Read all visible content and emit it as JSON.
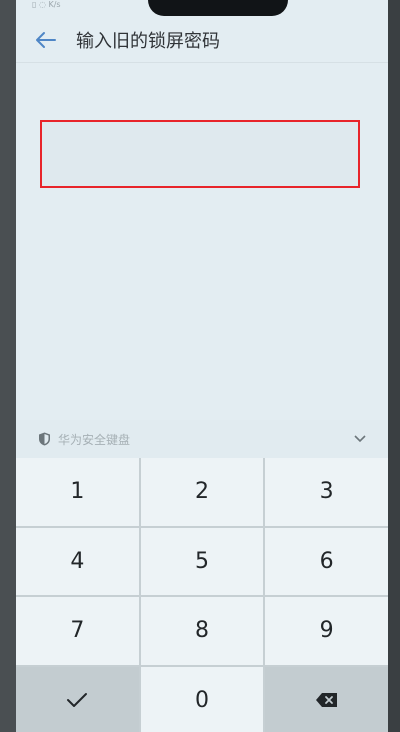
{
  "header": {
    "title": "输入旧的锁屏密码"
  },
  "password_field": {
    "value": ""
  },
  "keyboard": {
    "name": "华为安全键盘",
    "keys": [
      "1",
      "2",
      "3",
      "4",
      "5",
      "6",
      "7",
      "8",
      "9",
      "✓",
      "0",
      "⌫"
    ]
  },
  "colors": {
    "highlight": "#e8242a",
    "screen_bg": "#e3edf2"
  },
  "icons": {
    "back": "arrow-left-icon",
    "shield": "shield-icon",
    "collapse": "chevron-down-icon",
    "confirm": "check-icon",
    "delete": "backspace-icon"
  }
}
